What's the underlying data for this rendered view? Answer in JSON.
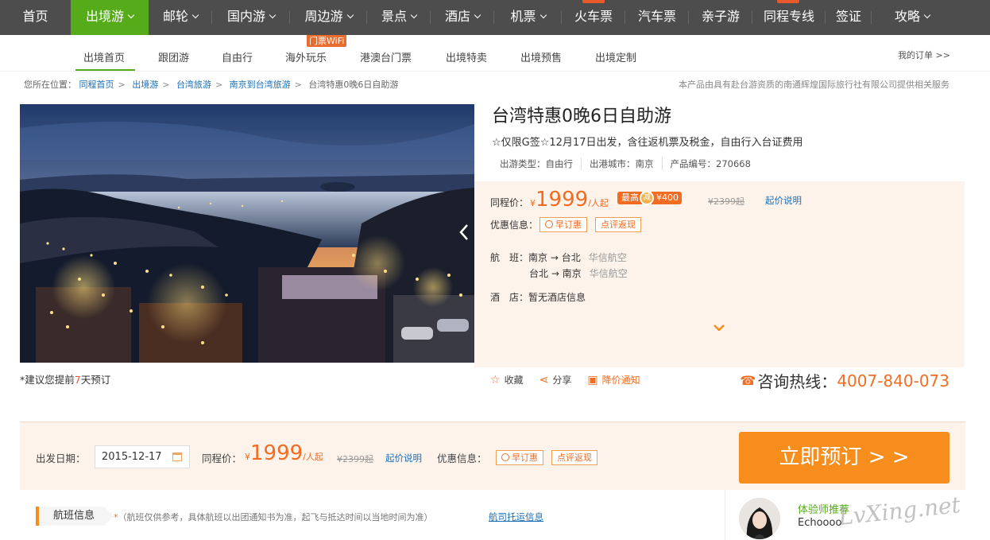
{
  "topnav": {
    "items": [
      {
        "label": "首页",
        "caret": false
      },
      {
        "label": "出境游",
        "caret": true
      },
      {
        "label": "邮轮",
        "caret": true
      },
      {
        "label": "国内游",
        "caret": true
      },
      {
        "label": "周边游",
        "caret": true
      },
      {
        "label": "景点",
        "caret": true
      },
      {
        "label": "酒店",
        "caret": true
      },
      {
        "label": "机票",
        "caret": true
      },
      {
        "label": "火车票",
        "caret": false
      },
      {
        "label": "汽车票",
        "caret": false
      },
      {
        "label": "亲子游",
        "caret": false
      },
      {
        "label": "同程专线",
        "caret": false
      },
      {
        "label": "签证",
        "caret": false
      },
      {
        "label": "攻略",
        "caret": true
      }
    ],
    "active_index": 1,
    "colors": {
      "bar": "#4d4d4d",
      "active": "#56ab1a",
      "flag": "#e95a2a"
    }
  },
  "subnav": {
    "items": [
      "出境首页",
      "跟团游",
      "自由行",
      "海外玩乐",
      "港澳台门票",
      "出境特卖",
      "出境预售",
      "出境定制"
    ],
    "badge": "门票WiFi",
    "my_order": "我的订单 >>"
  },
  "breadcrumb": {
    "prefix": "您所在位置：",
    "links": [
      "同程首页",
      "出境游",
      "台湾旅游",
      "南京到台湾旅游"
    ],
    "current": "台湾特惠0晚6日自助游",
    "separator": ">"
  },
  "provider_note": "本产品由具有赴台游资质的南通辉煌国际旅行社有限公司提供相关服务",
  "product": {
    "title": "台湾特惠0晚6日自助游",
    "subtitle": "☆仅限G签☆12月17日出发，含往返机票及税金，自由行入台证费用",
    "meta": [
      "出游类型：自由行",
      "出港城市：南京",
      "产品编号：270668"
    ]
  },
  "price": {
    "label": "同程价：",
    "currency": "¥",
    "value": "1999",
    "unit": "/人起",
    "max_label": "最高",
    "reduce_char": "减",
    "reduce_amount": "¥400",
    "original": "¥2399起",
    "explain_link": "起价说明"
  },
  "discount": {
    "label": "优惠信息：",
    "tags": [
      "早订惠",
      "点评返现"
    ]
  },
  "flights": {
    "label": "航　班：",
    "rows": [
      {
        "route": "南京 → 台北",
        "airline": "华信航空"
      },
      {
        "route": "台北 → 南京",
        "airline": "华信航空"
      }
    ]
  },
  "hotel": {
    "label": "酒　店：",
    "value": "暂无酒店信息"
  },
  "actions": {
    "favorite": "收藏",
    "share": "分享",
    "price_alert": "降价通知"
  },
  "hotline": {
    "label": "咨询热线：",
    "number": "4007-840-073"
  },
  "advance_note": {
    "prefix": "*建议您提前",
    "days": "7",
    "suffix": "天预订"
  },
  "booking": {
    "date_label": "出发日期：",
    "date_value": "2015-12-17",
    "price_label": "同程价：",
    "currency": "¥",
    "price": "1999",
    "unit": "/人起",
    "original": "¥2399起",
    "explain_link": "起价说明",
    "discount_label": "优惠信息：",
    "tags": [
      "早订惠",
      "点评返现"
    ],
    "button": "立即预订 > >"
  },
  "flight_section": {
    "tab": "航班信息",
    "note_star": "*",
    "note": "（航班仅供参考，具体航班以出团通知书为准，起飞与抵达时间以当地时间为准）",
    "link": "航司托运信息"
  },
  "recommender": {
    "title": "体验师推荐",
    "name": "Echoooo"
  },
  "watermark": "LvXing.net",
  "colors": {
    "orange": "#f26c22",
    "green": "#56ab1a",
    "button": "#f78d1c",
    "link": "#1b6eb6",
    "panel": "#fdf3ea"
  }
}
